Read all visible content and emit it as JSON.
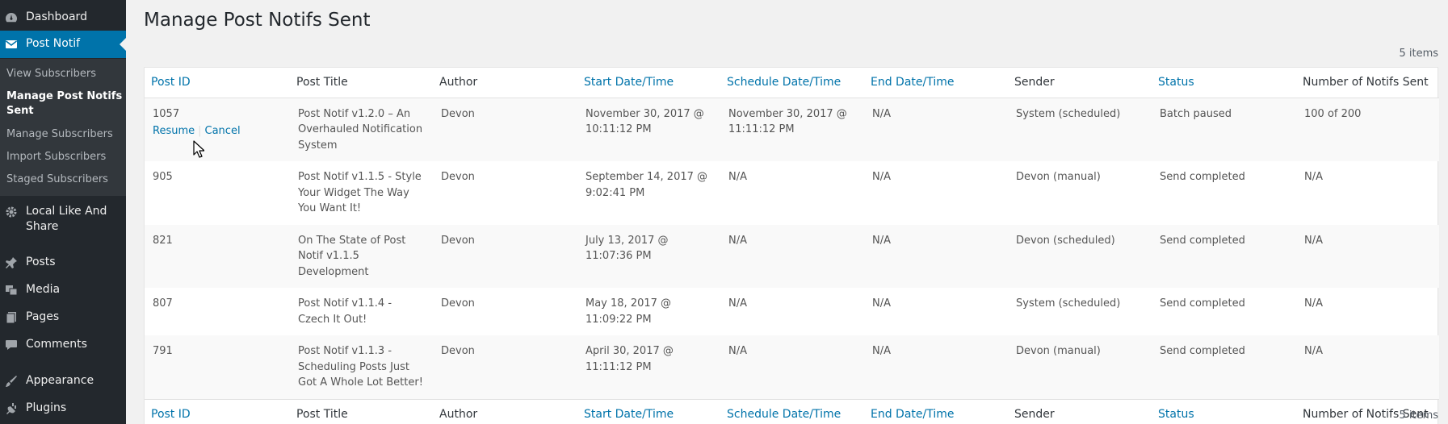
{
  "sidebar": {
    "items": [
      {
        "label": "Dashboard",
        "icon": "dashboard-icon"
      },
      {
        "label": "Post Notif",
        "icon": "email-icon"
      },
      {
        "label": "Local Like And Share",
        "icon": "gear-icon"
      },
      {
        "label": "Posts",
        "icon": "pin-icon"
      },
      {
        "label": "Media",
        "icon": "media-icon"
      },
      {
        "label": "Pages",
        "icon": "pages-icon"
      },
      {
        "label": "Comments",
        "icon": "comments-icon"
      },
      {
        "label": "Appearance",
        "icon": "paintbrush-icon"
      },
      {
        "label": "Plugins",
        "icon": "plugin-icon"
      }
    ],
    "submenu": [
      {
        "label": "View Subscribers"
      },
      {
        "label": "Manage Post Notifs Sent"
      },
      {
        "label": "Manage Subscribers"
      },
      {
        "label": "Import Subscribers"
      },
      {
        "label": "Staged Subscribers"
      }
    ]
  },
  "page": {
    "title": "Manage Post Notifs Sent",
    "items_count": "5 items"
  },
  "table": {
    "columns": [
      "Post ID",
      "Post Title",
      "Author",
      "Start Date/Time",
      "Schedule Date/Time",
      "End Date/Time",
      "Sender",
      "Status",
      "Number of Notifs Sent"
    ],
    "rows": [
      {
        "post_id": "1057",
        "title": "Post Notif v1.2.0 – An Overhauled Notification System",
        "author": "Devon",
        "start": "November 30, 2017 @ 10:11:12 PM",
        "schedule": "November 30, 2017 @ 11:11:12 PM",
        "end": "N/A",
        "sender": "System (scheduled)",
        "status": "Batch paused",
        "notifs": "100 of 200"
      },
      {
        "post_id": "905",
        "title": "Post Notif v1.1.5 - Style Your Widget The Way You Want It!",
        "author": "Devon",
        "start": "September 14, 2017 @ 9:02:41 PM",
        "schedule": "N/A",
        "end": "N/A",
        "sender": "Devon (manual)",
        "status": "Send completed",
        "notifs": "N/A"
      },
      {
        "post_id": "821",
        "title": "On The State of Post Notif v1.1.5 Development",
        "author": "Devon",
        "start": "July 13, 2017 @ 11:07:36 PM",
        "schedule": "N/A",
        "end": "N/A",
        "sender": "Devon (scheduled)",
        "status": "Send completed",
        "notifs": "N/A"
      },
      {
        "post_id": "807",
        "title": "Post Notif v1.1.4 - Czech It Out!",
        "author": "Devon",
        "start": "May 18, 2017 @ 11:09:22 PM",
        "schedule": "N/A",
        "end": "N/A",
        "sender": "System (scheduled)",
        "status": "Send completed",
        "notifs": "N/A"
      },
      {
        "post_id": "791",
        "title": "Post Notif v1.1.3 - Scheduling Posts Just Got A Whole Lot Better!",
        "author": "Devon",
        "start": "April 30, 2017 @ 11:11:12 PM",
        "schedule": "N/A",
        "end": "N/A",
        "sender": "Devon (manual)",
        "status": "Send completed",
        "notifs": "N/A"
      }
    ],
    "row_actions": {
      "resume": "Resume",
      "cancel": "Cancel"
    }
  },
  "colors": {
    "sidebar_bg": "#23282d",
    "submenu_bg": "#32373c",
    "accent": "#0073aa",
    "link": "#0073aa"
  }
}
